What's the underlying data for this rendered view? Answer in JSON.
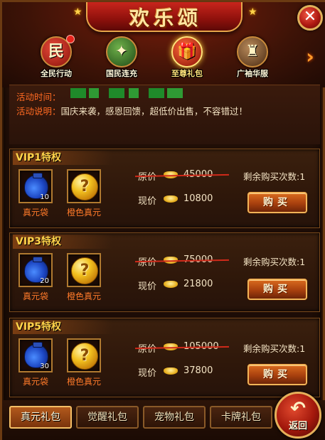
{
  "header": {
    "title": "欢乐颂",
    "close_label": "✕",
    "more_arrow": "›"
  },
  "nav_tabs": [
    {
      "label": "全民行动",
      "icon": "min-badge-icon",
      "glyph": "民",
      "color": "#c0261c",
      "active": false
    },
    {
      "label": "国民连充",
      "icon": "fireworks-icon",
      "glyph": "✦",
      "color": "#2e6c2a",
      "active": false
    },
    {
      "label": "至尊礼包",
      "icon": "gift-box-icon",
      "glyph": "🎁",
      "color": "#b0200f",
      "active": true
    },
    {
      "label": "广袖华服",
      "icon": "armor-icon",
      "glyph": "♜",
      "color": "#6a4a2a",
      "active": false
    }
  ],
  "info": {
    "time_key": "活动时间：",
    "desc_key": "活动说明：",
    "desc_val": "国庆来袭，感恩回馈，超低价出售，不容错过！"
  },
  "vip_cards": [
    {
      "title": "VIP1特权",
      "items": [
        {
          "label": "真元袋",
          "qty": "10",
          "icon": "blue-pouch-icon"
        },
        {
          "label": "橙色真元",
          "icon": "gold-orb-icon"
        }
      ],
      "original_label": "原价",
      "original_price": "45000",
      "current_label": "现价",
      "current_price": "10800",
      "remain_label": "剩余购买次数:",
      "remain_count": "1",
      "buy_label": "购买"
    },
    {
      "title": "VIP3特权",
      "items": [
        {
          "label": "真元袋",
          "qty": "20",
          "icon": "blue-pouch-icon"
        },
        {
          "label": "橙色真元",
          "icon": "gold-orb-icon"
        }
      ],
      "original_label": "原价",
      "original_price": "75000",
      "current_label": "现价",
      "current_price": "21800",
      "remain_label": "剩余购买次数:",
      "remain_count": "1",
      "buy_label": "购买"
    },
    {
      "title": "VIP5特权",
      "items": [
        {
          "label": "真元袋",
          "qty": "30",
          "icon": "blue-pouch-icon"
        },
        {
          "label": "橙色真元",
          "icon": "gold-orb-icon"
        }
      ],
      "original_label": "原价",
      "original_price": "105000",
      "current_label": "现价",
      "current_price": "37800",
      "remain_label": "剩余购买次数:",
      "remain_count": "1",
      "buy_label": "购买"
    }
  ],
  "bottom_tabs": [
    {
      "label": "真元礼包",
      "active": true
    },
    {
      "label": "觉醒礼包",
      "active": false
    },
    {
      "label": "宠物礼包",
      "active": false
    },
    {
      "label": "卡牌礼包",
      "active": false
    }
  ],
  "back": {
    "label": "返回",
    "icon": "back-arrow-icon"
  }
}
